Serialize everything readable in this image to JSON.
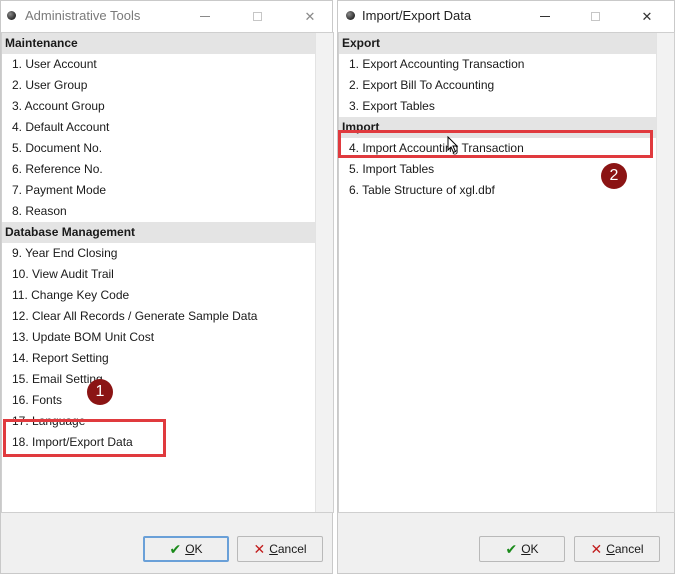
{
  "left_window": {
    "title": "Administrative Tools",
    "minimize_glyph": "—",
    "close_glyph": "✕",
    "sections": [
      {
        "header": "Maintenance",
        "items": [
          "1. User Account",
          "2. User Group",
          "3. Account Group",
          "4. Default Account",
          "5. Document No.",
          "6. Reference No.",
          "7. Payment Mode",
          "8. Reason"
        ]
      },
      {
        "header": "Database Management",
        "items": [
          "9. Year End Closing",
          "10. View Audit Trail",
          "11. Change Key Code",
          "12. Clear All Records / Generate Sample Data",
          "13. Update BOM Unit Cost",
          "14. Report Setting",
          "15. Email Setting",
          "16. Fonts",
          "17. Language",
          "18. Import/Export Data"
        ]
      }
    ],
    "ok_label": "OK",
    "cancel_label": "Cancel",
    "badge": "1"
  },
  "right_window": {
    "title": "Import/Export Data",
    "minimize_glyph": "—",
    "close_glyph": "✕",
    "sections": [
      {
        "header": "Export",
        "items": [
          "1. Export Accounting Transaction",
          "2. Export Bill To Accounting",
          "3. Export Tables"
        ]
      },
      {
        "header": "Import",
        "items": [
          "4. Import Accounting Transaction",
          "5. Import Tables",
          "6. Table Structure of xgl.dbf"
        ]
      }
    ],
    "ok_label": "OK",
    "cancel_label": "Cancel",
    "badge": "2"
  },
  "colors": {
    "highlight_border": "#e03a3e",
    "badge_bg": "#8b1414",
    "section_bg": "#e4e4e4"
  }
}
